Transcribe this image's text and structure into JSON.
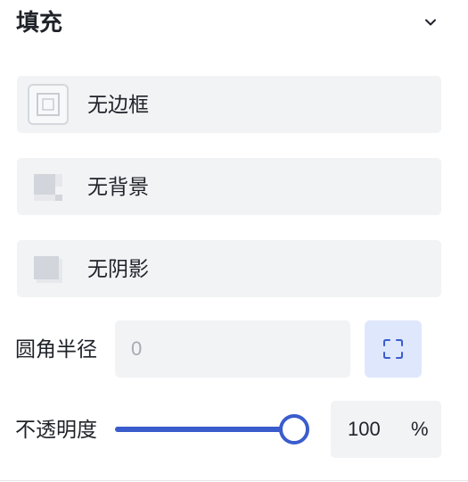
{
  "section": {
    "title": "填充",
    "collapse_icon": "chevron-down-icon"
  },
  "options": [
    {
      "label": "无边框",
      "icon": "no-border-icon"
    },
    {
      "label": "无背景",
      "icon": "no-background-icon"
    },
    {
      "label": "无阴影",
      "icon": "no-shadow-icon"
    }
  ],
  "corner_radius": {
    "label": "圆角半径",
    "value": "",
    "placeholder": "0",
    "toggle_icon": "corner-radius-icon"
  },
  "opacity": {
    "label": "不透明度",
    "slider_fraction": 0.92,
    "value": "100",
    "unit": "%"
  },
  "colors": {
    "accent": "#3a5ccc",
    "card_bg": "#f2f3f5",
    "toggle_bg": "#dfe7fd",
    "text": "#1f2329",
    "placeholder": "#a6abb3"
  }
}
